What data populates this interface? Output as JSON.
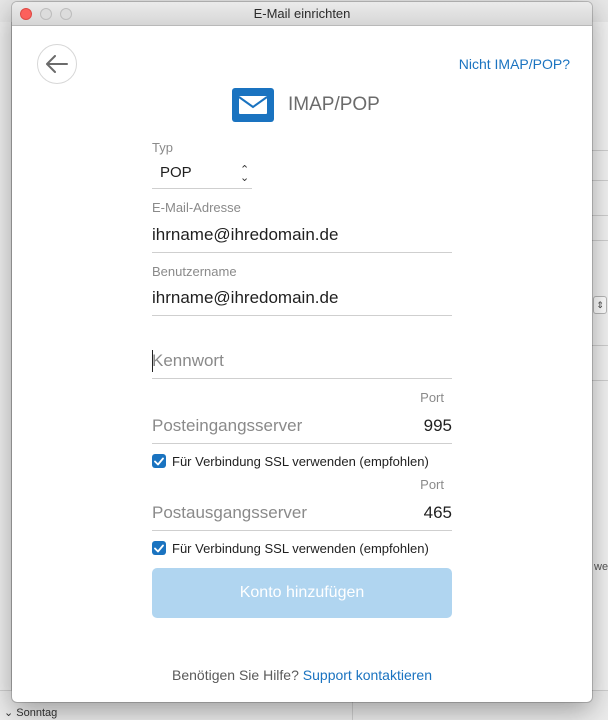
{
  "window": {
    "title": "E-Mail einrichten"
  },
  "header": {
    "not_imap_link": "Nicht IMAP/POP?",
    "brand_label": "IMAP/POP"
  },
  "form": {
    "type": {
      "label": "Typ",
      "value": "POP"
    },
    "email": {
      "label": "E-Mail-Adresse",
      "value": "ihrname@ihredomain.de"
    },
    "username": {
      "label": "Benutzername",
      "value": "ihrname@ihredomain.de"
    },
    "password": {
      "placeholder": "Kennwort",
      "value": ""
    },
    "incoming": {
      "port_label": "Port",
      "server_placeholder": "Posteingangsserver",
      "port_value": "995",
      "ssl_checked": true,
      "ssl_label": "Für Verbindung SSL verwenden (empfohlen)"
    },
    "outgoing": {
      "port_label": "Port",
      "server_placeholder": "Postausgangsserver",
      "port_value": "465",
      "ssl_checked": true,
      "ssl_label": "Für Verbindung SSL verwenden (empfohlen)"
    },
    "submit_label": "Konto hinzufügen"
  },
  "footer": {
    "help_text": "Benötigen Sie Hilfe?",
    "help_link": "Support kontaktieren"
  },
  "background": {
    "bottom_label": "Sonntag",
    "right_fragment": "weit"
  },
  "colors": {
    "accent": "#1a73c0",
    "button_disabled": "#b0d5f0",
    "close": "#fc605c"
  },
  "icons": {
    "back": "arrow-left-icon",
    "mail": "envelope-icon",
    "checkbox": "checkmark-icon",
    "select": "chevron-up-down-icon"
  }
}
